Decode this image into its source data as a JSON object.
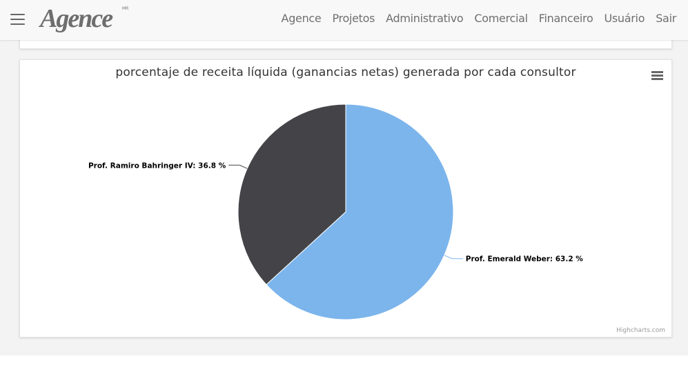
{
  "navbar": {
    "logo_text": "Agence",
    "logo_mark": "MR",
    "links": [
      "Agence",
      "Projetos",
      "Administrativo",
      "Comercial",
      "Financeiro",
      "Usuário",
      "Sair"
    ]
  },
  "chart": {
    "credits": "Highcharts.com"
  },
  "chart_data": {
    "type": "pie",
    "title": "porcentaje de receita líquida (ganancias netas) generada por cada consultor",
    "series": [
      {
        "name": "Prof. Emerald Weber",
        "value": 63.2,
        "color": "#7cb5ec"
      },
      {
        "name": "Prof. Ramiro Bahringer IV",
        "value": 36.8,
        "color": "#434348"
      }
    ],
    "labels": [
      "Prof. Emerald Weber: 63.2 %",
      "Prof. Ramiro Bahringer IV: 36.8 %"
    ],
    "legend": "none",
    "data_labels": "outside"
  }
}
